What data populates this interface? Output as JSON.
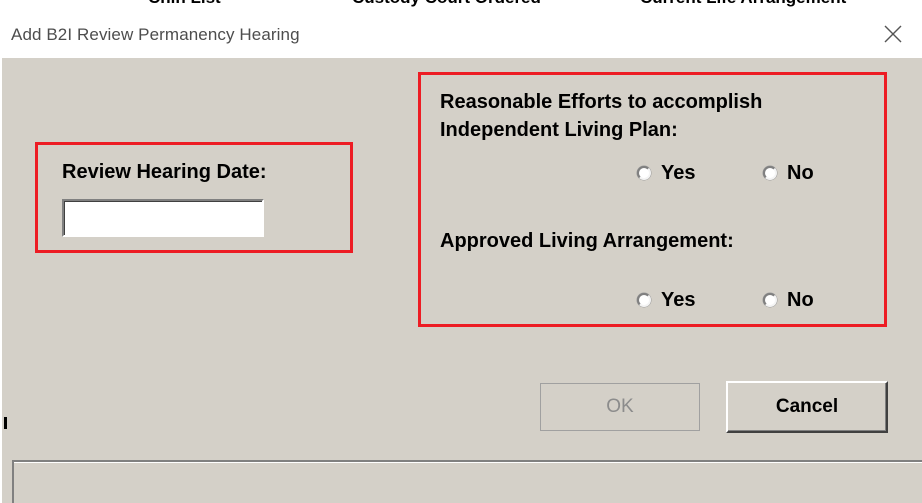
{
  "window": {
    "title": "Add B2I Review Permanency Hearing",
    "close_icon": "close-icon"
  },
  "background_window": {
    "fragments": [
      "Chin List",
      "Custody Court Ordered",
      "Current Life Arrangement"
    ]
  },
  "review_date": {
    "label": "Review Hearing Date:",
    "value": "",
    "placeholder": ""
  },
  "reasonable_efforts": {
    "label_line1": "Reasonable Efforts to accomplish",
    "label_line2": "Independent Living Plan:",
    "options": [
      {
        "label": "Yes",
        "selected": false
      },
      {
        "label": "No",
        "selected": false
      }
    ]
  },
  "approved_living": {
    "label": "Approved Living Arrangement:",
    "options": [
      {
        "label": "Yes",
        "selected": false
      },
      {
        "label": "No",
        "selected": false
      }
    ]
  },
  "buttons": {
    "ok": "OK",
    "ok_enabled": false,
    "cancel": "Cancel"
  },
  "colors": {
    "dialog_background": "#d4d0c8",
    "highlight_border": "#ed1c24",
    "title_bar": "#ffffff",
    "disabled_text": "#8c8c8c"
  }
}
